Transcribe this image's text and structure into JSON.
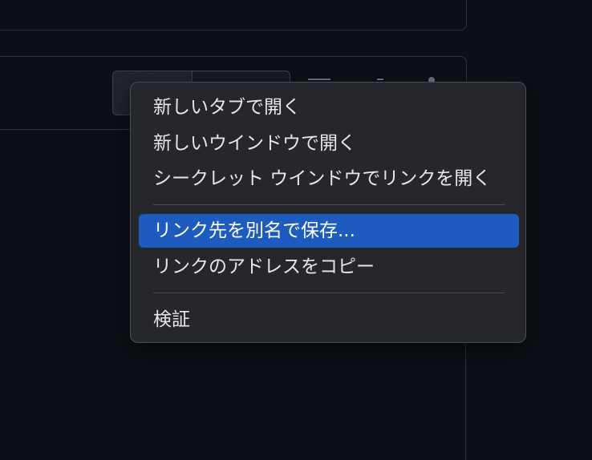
{
  "context_menu": {
    "items": [
      {
        "label": "新しいタブで開く"
      },
      {
        "label": "新しいウインドウで開く"
      },
      {
        "label": "シークレット ウインドウでリンクを開く"
      },
      {
        "label": "リンク先を別名で保存..."
      },
      {
        "label": "リンクのアドレスをコピー"
      },
      {
        "label": "検証"
      }
    ],
    "highlighted_item": "リンク先を別名で保存...",
    "highlight_color": "#1d5bbf",
    "background_color": "#25272d"
  },
  "page": {
    "background_color": "#0d1117",
    "border_color": "#30363d"
  }
}
